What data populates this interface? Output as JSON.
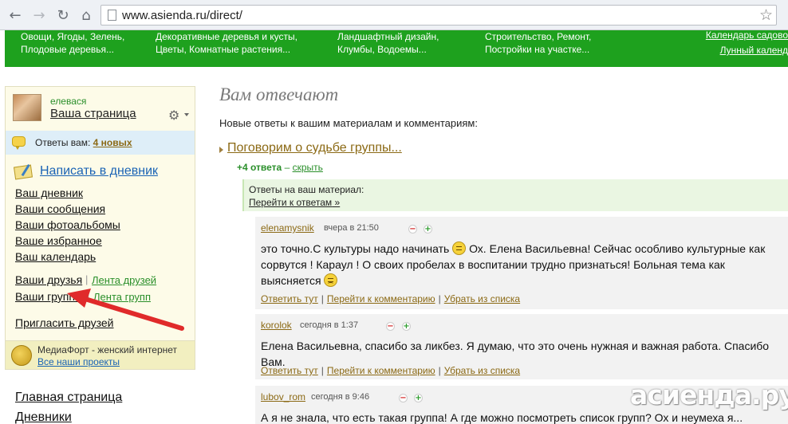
{
  "browser": {
    "url": "www.asienda.ru/direct/",
    "icons": [
      "back-icon",
      "forward-icon",
      "reload-icon",
      "home-icon",
      "page-icon",
      "star-icon"
    ]
  },
  "site_nav": {
    "col1": [
      "Овощи, Ягоды, Зелень,",
      "Плодовые деревья..."
    ],
    "col2": [
      "Декоративные деревья и кусты,",
      "Цветы, Комнатные растения..."
    ],
    "col3": [
      "Ландшафтный дизайн,",
      "Клумбы, Водоемы..."
    ],
    "col4": [
      "Строительство, Ремонт,",
      "Постройки на участке..."
    ],
    "col5": [
      "Календарь садово",
      "Лунный календ"
    ]
  },
  "sidebar": {
    "user_name": "елевася",
    "user_page": "Ваша страница",
    "replies_label": "Ответы вам:",
    "replies_count": "4 новых",
    "write_diary": "Написать в дневник",
    "links": [
      "Ваш дневник",
      "Ваши сообщения",
      "Ваши фотоальбомы",
      "Ваше избранное",
      "Ваш календарь"
    ],
    "friends": "Ваши друзья",
    "friends_feed": "Лента друзей",
    "groups": "Ваши группы",
    "groups_feed": "Лента групп",
    "invite": "Пригласить друзей",
    "media_title": "МедиаФорт - женский интернет",
    "media_link": "Все наши проекты"
  },
  "bottom_links": [
    "Главная страница",
    "Дневники"
  ],
  "main": {
    "title": "Вам отвечают",
    "subtitle": "Новые ответы к вашим материалам и комментариям:",
    "post_title": "Поговорим о судьбе группы...",
    "reply_count": "+4 ответа",
    "hide": "скрыть",
    "notice_line1": "Ответы на ваш материал:",
    "notice_link": "Перейти к ответам",
    "notice_suffix": " »"
  },
  "comments": [
    {
      "author": "elenamysnik",
      "time": "вчера в 21:50",
      "text_a": "это точно.С культуры надо начинать ",
      "text_b": " Ох. Елена Васильевна! Сейчас особливо культурные как сорвутся ! Караул ! О своих пробелах в воспитании трудно признаться! Больная тема как выясняется ",
      "reply": "Ответить тут",
      "goto": "Перейти к комментарию",
      "remove": "Убрать из списка"
    },
    {
      "author": "korolok",
      "time": "сегодня в 1:37",
      "text": "Елена Васильевна, спасибо за ликбез. Я думаю, что это очень нужная и важная работа. Спасибо Вам.",
      "reply": "Ответить тут",
      "goto": "Перейти к комментарию",
      "remove": "Убрать из списка"
    },
    {
      "author": "lubov_rom",
      "time": "сегодня в 9:46",
      "text": "А я не знала, что есть такая группа! А где можно посмотреть список групп? Ох и неумеха я..."
    }
  ],
  "vote": {
    "minus": "−",
    "plus": "+"
  },
  "watermark": "асиенда.ру"
}
